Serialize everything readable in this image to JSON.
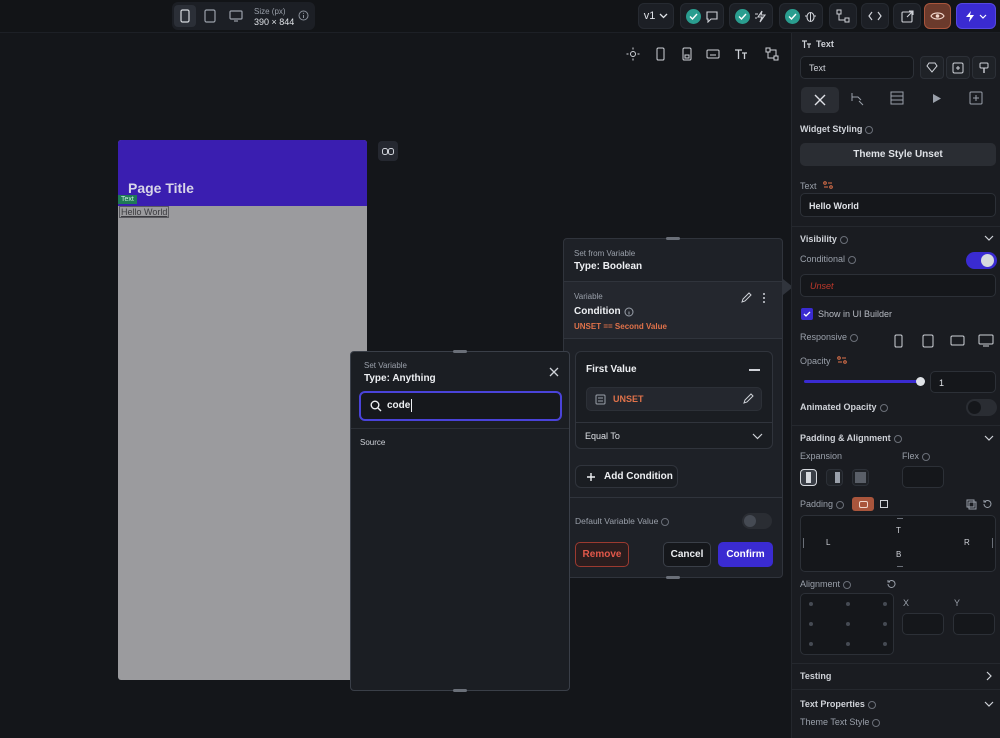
{
  "topbar": {
    "size_label": "Size (px)",
    "size_value": "390 × 844",
    "version": "v1"
  },
  "canvas": {
    "page_title": "Page Title",
    "text_tag": "Text",
    "hello_text": "Hello World"
  },
  "set_from_variable": {
    "header_small": "Set from Variable",
    "header_type": "Type: Boolean",
    "variable_label": "Variable",
    "variable_name": "Condition",
    "variable_expr": "UNSET == Second Value",
    "first_value_label": "First Value",
    "first_value": "UNSET",
    "operator": "Equal To",
    "add_condition": "Add Condition",
    "default_value_label": "Default Variable Value",
    "remove": "Remove",
    "cancel": "Cancel",
    "confirm": "Confirm"
  },
  "set_variable": {
    "header_small": "Set Variable",
    "header_type": "Type: Anything",
    "search_value": "code",
    "source_label": "Source"
  },
  "right_panel": {
    "widget_type": "Text",
    "widget_name": "Text",
    "widget_styling": "Widget Styling",
    "theme_style": "Theme Style Unset",
    "text_label": "Text",
    "text_value": "Hello World",
    "visibility": "Visibility",
    "conditional": "Conditional",
    "unset": "Unset",
    "show_in_ui_builder": "Show in UI Builder",
    "responsive": "Responsive",
    "opacity": "Opacity",
    "opacity_value": "1",
    "animated_opacity": "Animated Opacity",
    "padding_alignment": "Padding & Alignment",
    "expansion": "Expansion",
    "flex": "Flex",
    "padding": "Padding",
    "pad_t": "T",
    "pad_l": "L",
    "pad_r": "R",
    "pad_b": "B",
    "alignment": "Alignment",
    "align_x": "X",
    "align_y": "Y",
    "testing": "Testing",
    "text_properties": "Text Properties",
    "theme_text_style": "Theme Text Style"
  },
  "colors": {
    "accent": "#3a1eb0",
    "primary_button": "#3a2bd1",
    "unset_orange": "#e0724a",
    "check_teal": "#2a9d8f"
  }
}
